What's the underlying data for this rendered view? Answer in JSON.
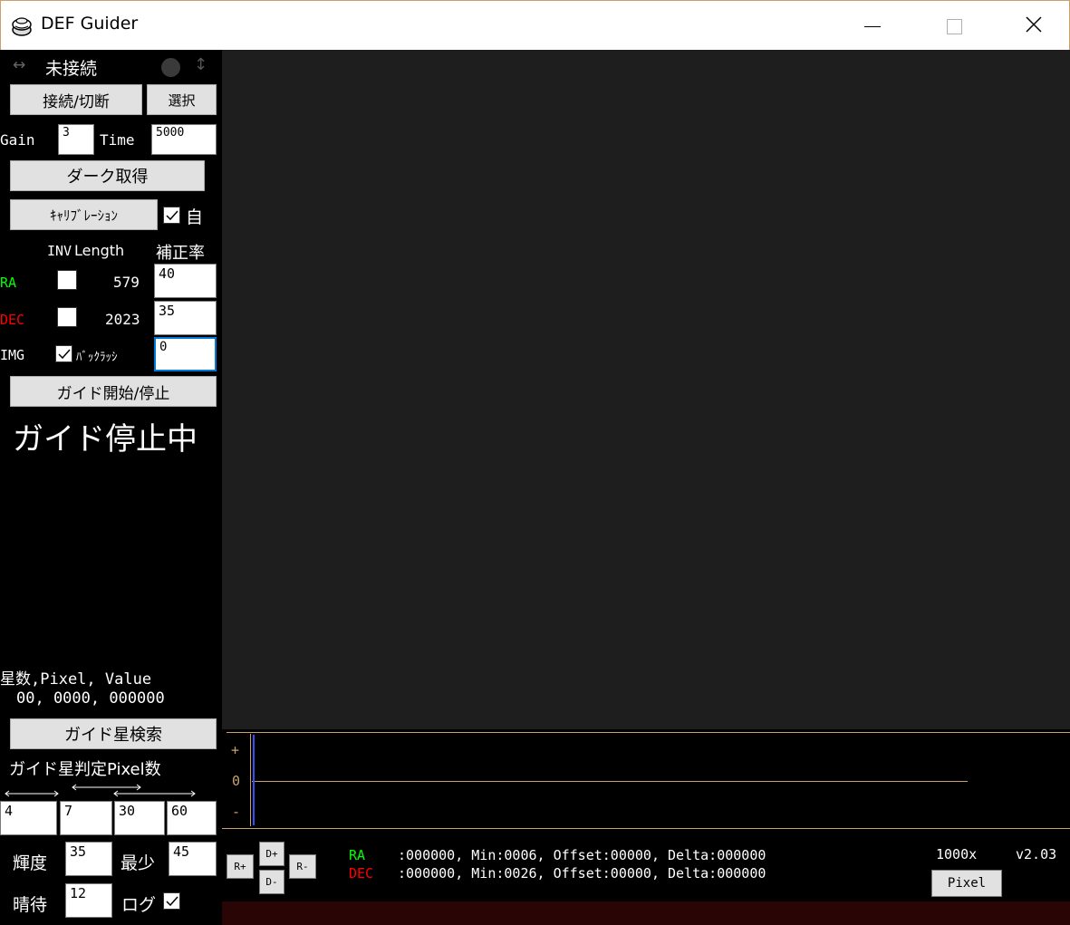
{
  "window": {
    "title": "DEF Guider",
    "minimize_glyph": "—",
    "close_glyph": "✕"
  },
  "status": {
    "arrow_h": "↔",
    "connection": "未接続",
    "arrow_v": "↕"
  },
  "buttons": {
    "connect": "接続/切断",
    "select": "選択",
    "dark": "ダーク取得",
    "calibration": "ｷｬﾘﾌﾞﾚｰｼｮﾝ",
    "guide_toggle": "ガイド開始/停止",
    "star_search": "ガイド星検索"
  },
  "gain": {
    "label": "Gain",
    "value": "3"
  },
  "time": {
    "label": "Time",
    "value": "5000"
  },
  "auto": {
    "label": "自",
    "checked": true
  },
  "table": {
    "header_inv": "INV",
    "header_length": "Length",
    "header_rate": "補正率",
    "ra": {
      "label": "RA",
      "length": "579",
      "rate": "40"
    },
    "dec": {
      "label": "DEC",
      "length": "2023",
      "rate": "35"
    },
    "img": {
      "label": "IMG",
      "backlash_label": "ﾊﾞｯｸﾗｯｼ",
      "backlash": "0"
    }
  },
  "guide_status": "ガイド停止中",
  "star_info": {
    "header": "星数,Pixel, Value",
    "values": "00, 0000, 000000"
  },
  "star_pixel": {
    "label": "ガイド星判定Pixel数",
    "values": [
      "4",
      "7",
      "30",
      "60"
    ]
  },
  "brightness": {
    "label": "輝度",
    "value": "35",
    "min_label": "最少",
    "min_value": "45"
  },
  "wait": {
    "label": "晴待",
    "value": "12",
    "log_label": "ログ"
  },
  "graph": {
    "plus": "+",
    "zero": "0",
    "minus": "-"
  },
  "direction": {
    "d_plus": "D+",
    "d_minus": "D-",
    "r_plus": "R+",
    "r_minus": "R-"
  },
  "readout": {
    "ra_label": "RA",
    "ra_text": ":000000, Min:0006, Offset:00000, Delta:000000",
    "dec_label": "DEC",
    "dec_text": ":000000, Min:0026, Offset:00000, Delta:000000",
    "zoom": "1000x",
    "version": "v2.03",
    "pixel_button": "Pixel"
  },
  "colors": {
    "ra": "#00ff00",
    "dec": "#ff0000",
    "graph_line": "#c9a26b",
    "cursor": "#3a4cff"
  }
}
